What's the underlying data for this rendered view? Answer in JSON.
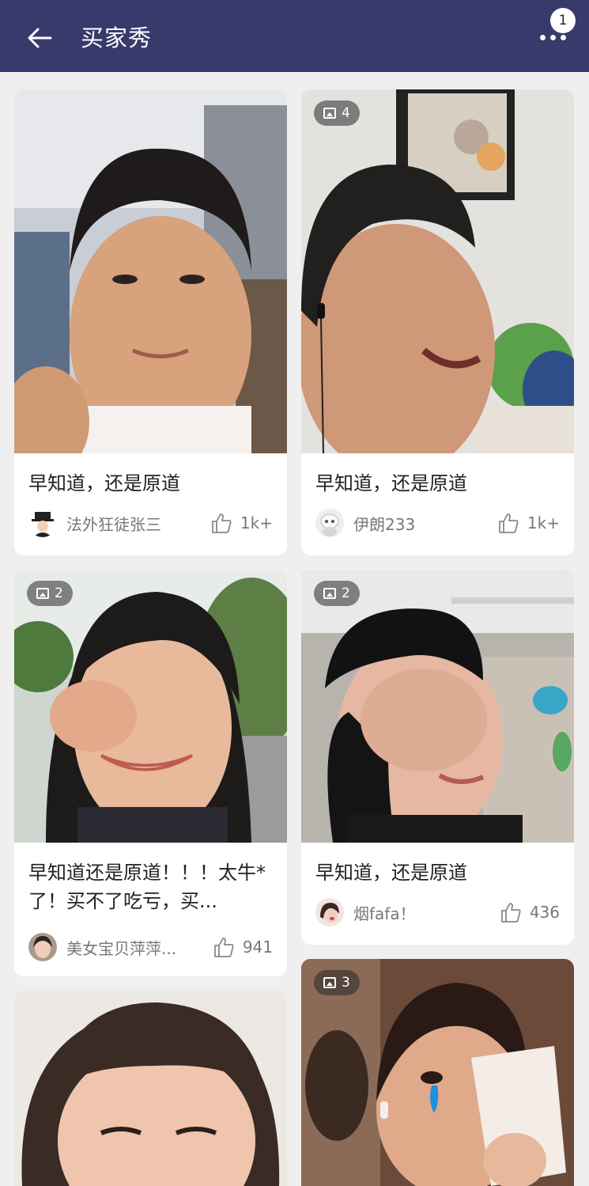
{
  "header": {
    "title": "买家秀",
    "notification_count": "1",
    "bg_color": "#373a6b"
  },
  "icons": {
    "back": "arrow-left-icon",
    "more": "more-dots-icon",
    "like": "thumbs-up-icon",
    "images": "image-icon"
  },
  "posts": [
    {
      "caption": "早知道，还是原道",
      "user": "法外狂徒张三",
      "likes": "1k+",
      "image_count": ""
    },
    {
      "caption": "早知道，还是原道",
      "user": "伊朗233",
      "likes": "1k+",
      "image_count": "4"
    },
    {
      "caption": "早知道还是原道！！！太牛*了！买不了吃亏，买...",
      "user": "美女宝贝萍萍...",
      "likes": "941",
      "image_count": "2"
    },
    {
      "caption": "早知道，还是原道",
      "user": "烟fafa！",
      "likes": "436",
      "image_count": "2"
    },
    {
      "caption": "",
      "user": "",
      "likes": "",
      "image_count": ""
    },
    {
      "caption": "",
      "user": "",
      "likes": "",
      "image_count": "3"
    }
  ]
}
